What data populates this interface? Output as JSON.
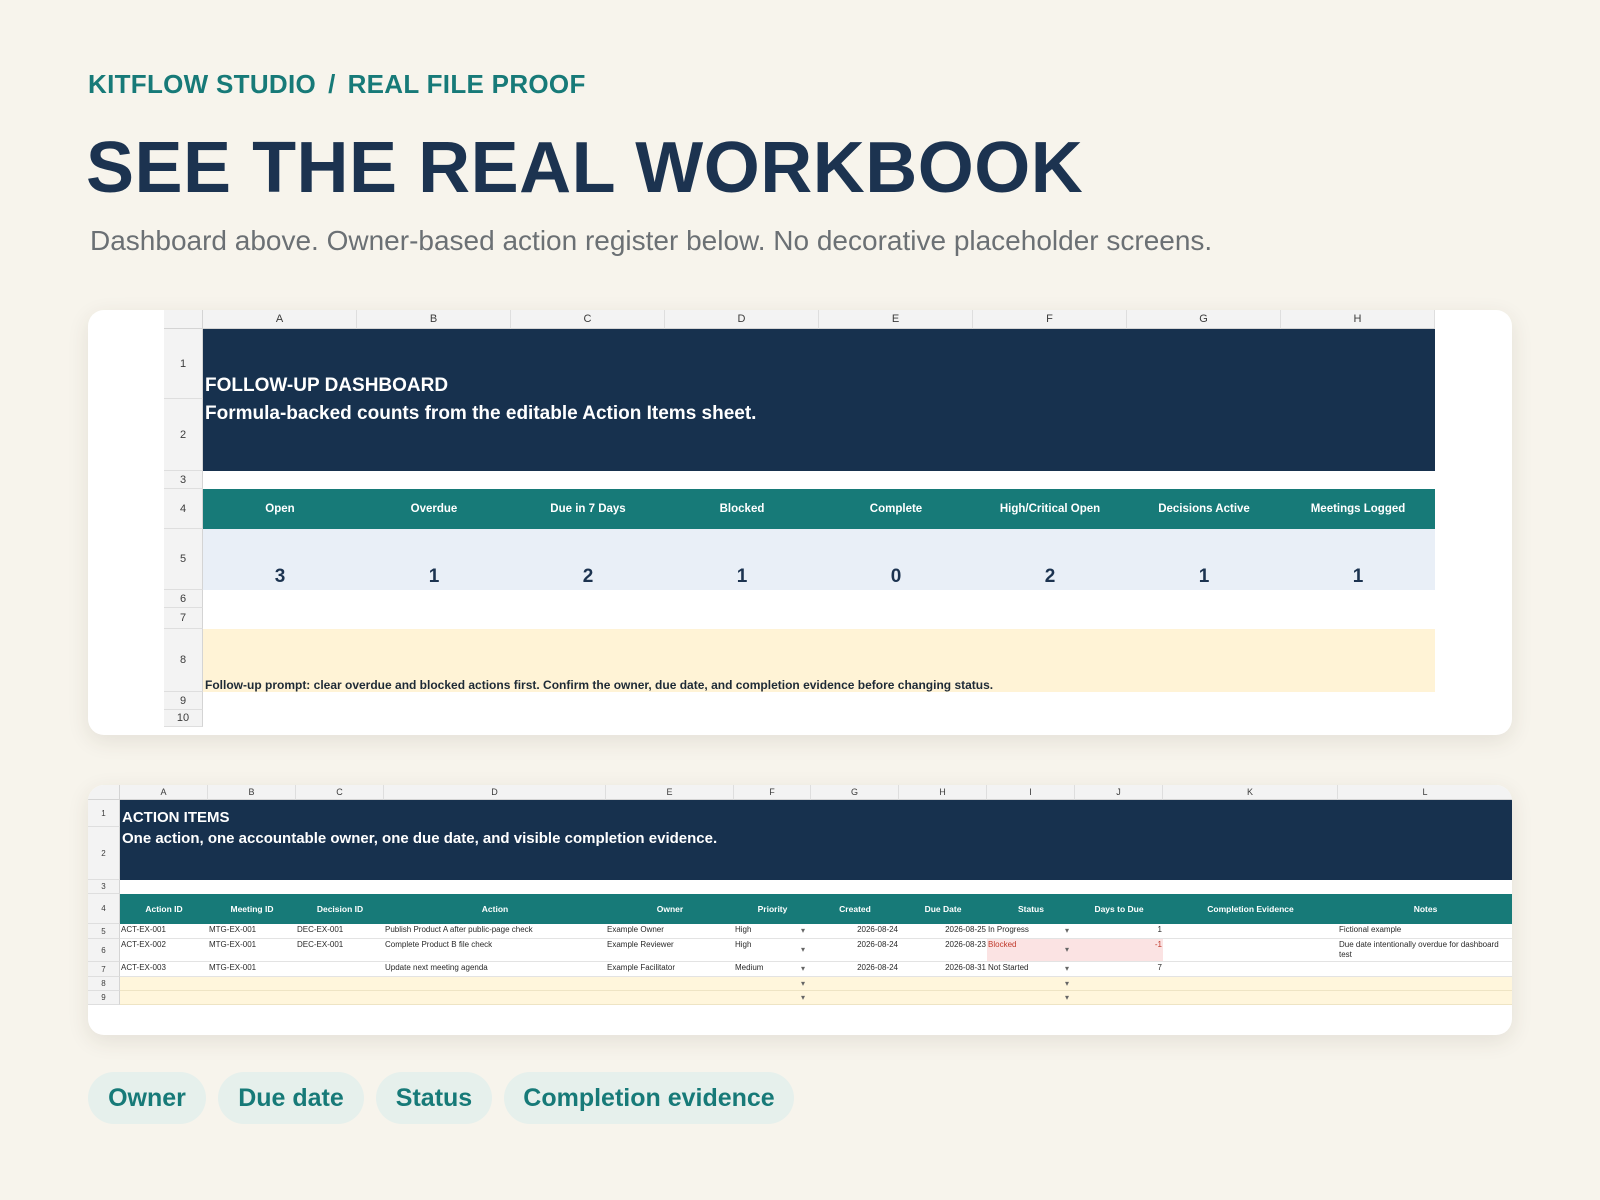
{
  "header": {
    "brand": "KITFLOW STUDIO",
    "separator": "/",
    "section": "REAL FILE PROOF",
    "title": "SEE THE REAL WORKBOOK",
    "subtitle": "Dashboard above. Owner-based action register below. No decorative placeholder screens."
  },
  "dashboard": {
    "columns": [
      "A",
      "B",
      "C",
      "D",
      "E",
      "F",
      "G",
      "H"
    ],
    "rows": [
      "1",
      "2",
      "3",
      "4",
      "5",
      "6",
      "7",
      "8",
      "9",
      "10"
    ],
    "title": "FOLLOW-UP DASHBOARD",
    "subtitle": "Formula-backed counts from the editable Action Items sheet.",
    "kpis": [
      {
        "label": "Open",
        "value": "3"
      },
      {
        "label": "Overdue",
        "value": "1"
      },
      {
        "label": "Due in 7 Days",
        "value": "2"
      },
      {
        "label": "Blocked",
        "value": "1"
      },
      {
        "label": "Complete",
        "value": "0"
      },
      {
        "label": "High/Critical Open",
        "value": "2"
      },
      {
        "label": "Decisions Active",
        "value": "1"
      },
      {
        "label": "Meetings Logged",
        "value": "1"
      }
    ],
    "prompt": "Follow-up prompt: clear overdue and blocked actions first. Confirm the owner, due date, and completion evidence before changing status."
  },
  "actions": {
    "columns": [
      "A",
      "B",
      "C",
      "D",
      "E",
      "F",
      "G",
      "H",
      "I",
      "J",
      "K",
      "L"
    ],
    "rows": [
      "1",
      "2",
      "3",
      "4",
      "5",
      "6",
      "7",
      "8",
      "9"
    ],
    "title": "ACTION ITEMS",
    "subtitle": "One action, one accountable owner, one due date, and visible completion evidence.",
    "headers": [
      "Action ID",
      "Meeting ID",
      "Decision ID",
      "Action",
      "Owner",
      "Priority",
      "Created",
      "Due Date",
      "Status",
      "Days to Due",
      "Completion Evidence",
      "Notes"
    ],
    "items": [
      {
        "action_id": "ACT-EX-001",
        "meeting_id": "MTG-EX-001",
        "decision_id": "DEC-EX-001",
        "action": "Publish Product A after public-page check",
        "owner": "Example Owner",
        "priority": "High",
        "created": "2026-08-24",
        "due": "2026-08-25",
        "status": "In Progress",
        "days": "1",
        "evidence": "",
        "notes": "Fictional example"
      },
      {
        "action_id": "ACT-EX-002",
        "meeting_id": "MTG-EX-001",
        "decision_id": "DEC-EX-001",
        "action": "Complete Product B file check",
        "owner": "Example Reviewer",
        "priority": "High",
        "created": "2026-08-24",
        "due": "2026-08-23",
        "status": "Blocked",
        "days": "-1",
        "evidence": "",
        "notes": "Due date intentionally overdue for dashboard test"
      },
      {
        "action_id": "ACT-EX-003",
        "meeting_id": "MTG-EX-001",
        "decision_id": "",
        "action": "Update next meeting agenda",
        "owner": "Example Facilitator",
        "priority": "Medium",
        "created": "2026-08-24",
        "due": "2026-08-31",
        "status": "Not Started",
        "days": "7",
        "evidence": "",
        "notes": ""
      }
    ]
  },
  "chips": [
    "Owner",
    "Due date",
    "Status",
    "Completion evidence"
  ]
}
